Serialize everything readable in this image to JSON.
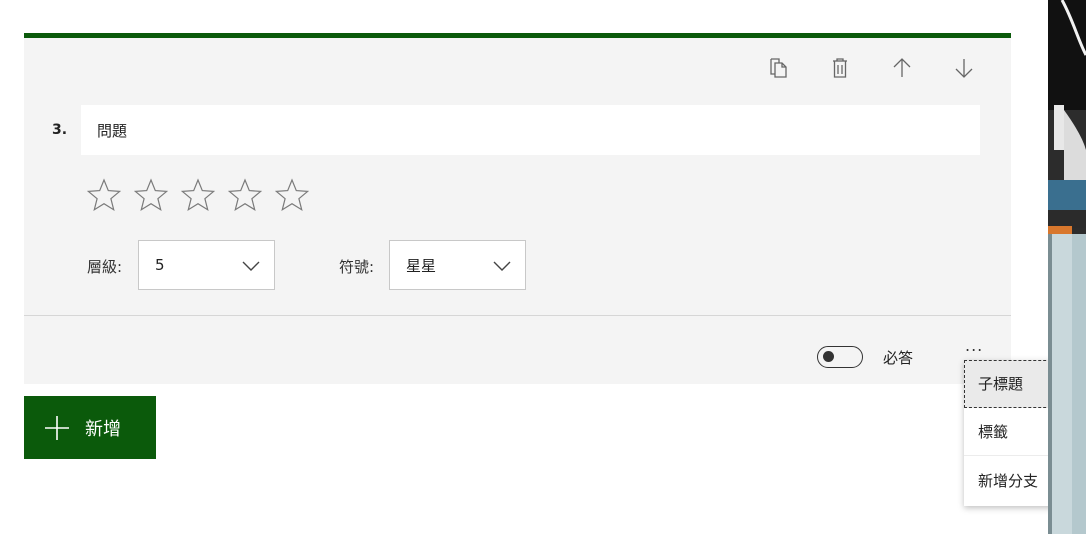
{
  "question": {
    "number": "3.",
    "title": "問題",
    "rating_stars": 5
  },
  "toolbar": {
    "copy_icon": "copy-icon",
    "delete_icon": "trash-icon",
    "move_up_icon": "arrow-up-icon",
    "move_down_icon": "arrow-down-icon"
  },
  "settings": {
    "levels_label": "層級:",
    "levels_value": "5",
    "symbol_label": "符號:",
    "symbol_value": "星星"
  },
  "footer": {
    "required_label": "必答",
    "required_on": false,
    "more_label": "..."
  },
  "add_button": {
    "label": "新增"
  },
  "context_menu": {
    "items": [
      {
        "label": "子標題"
      },
      {
        "label": "標籤"
      },
      {
        "label": "新增分支"
      }
    ]
  },
  "colors": {
    "accent": "#0b5a0b",
    "card_bg": "#f4f4f4"
  }
}
